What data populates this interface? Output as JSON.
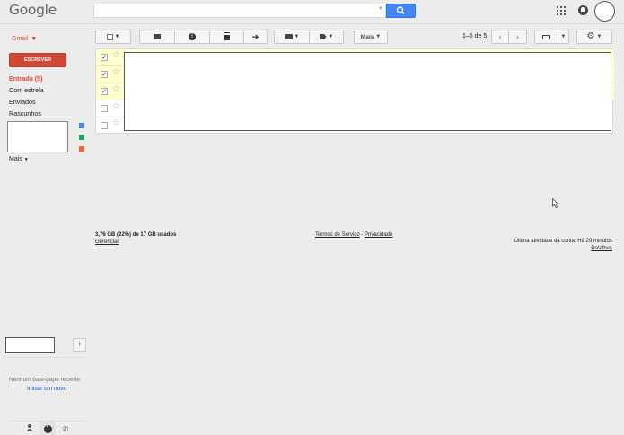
{
  "header": {
    "logo": "Google",
    "search": {
      "value": "",
      "placeholder": ""
    }
  },
  "toolbar": {
    "app_label": "Gmail",
    "more_button": "Mais",
    "page_count": "1–5 de 5"
  },
  "sidebar": {
    "compose": "ESCREVER",
    "items": [
      {
        "label": "Entrada (5)",
        "active": true
      },
      {
        "label": "Com estrela",
        "active": false
      },
      {
        "label": "Enviados",
        "active": false
      },
      {
        "label": "Rascunhos",
        "active": false
      }
    ],
    "label_colors": [
      "#4a86e8",
      "#16a765",
      "#f2662f"
    ],
    "more": "Mais"
  },
  "messages": [
    {
      "selected": true,
      "checked": "✓",
      "star": "☆"
    },
    {
      "selected": true,
      "checked": "✓",
      "star": "☆"
    },
    {
      "selected": true,
      "checked": "✓",
      "star": "☆"
    },
    {
      "selected": false,
      "checked": "",
      "star": "☆"
    },
    {
      "selected": false,
      "checked": "",
      "star": "☆"
    }
  ],
  "footer": {
    "storage": "3,76 GB (22%) de 17 GB usados",
    "manage": "Gerenciar",
    "terms": "Termos de Serviço",
    "separator": " - ",
    "privacy": "Privacidade",
    "activity": "Última atividade da conta: Há 29 minutos",
    "details": "Detalhes"
  },
  "chat": {
    "empty_text": "Nenhum bate-papo recente",
    "start_link": "Iniciar um novo",
    "add_symbol": "+"
  },
  "colors": {
    "brand_red": "#dd4b39",
    "compose_red": "#d14836",
    "search_blue": "#4285f4",
    "selected_row": "#ffffcc"
  }
}
